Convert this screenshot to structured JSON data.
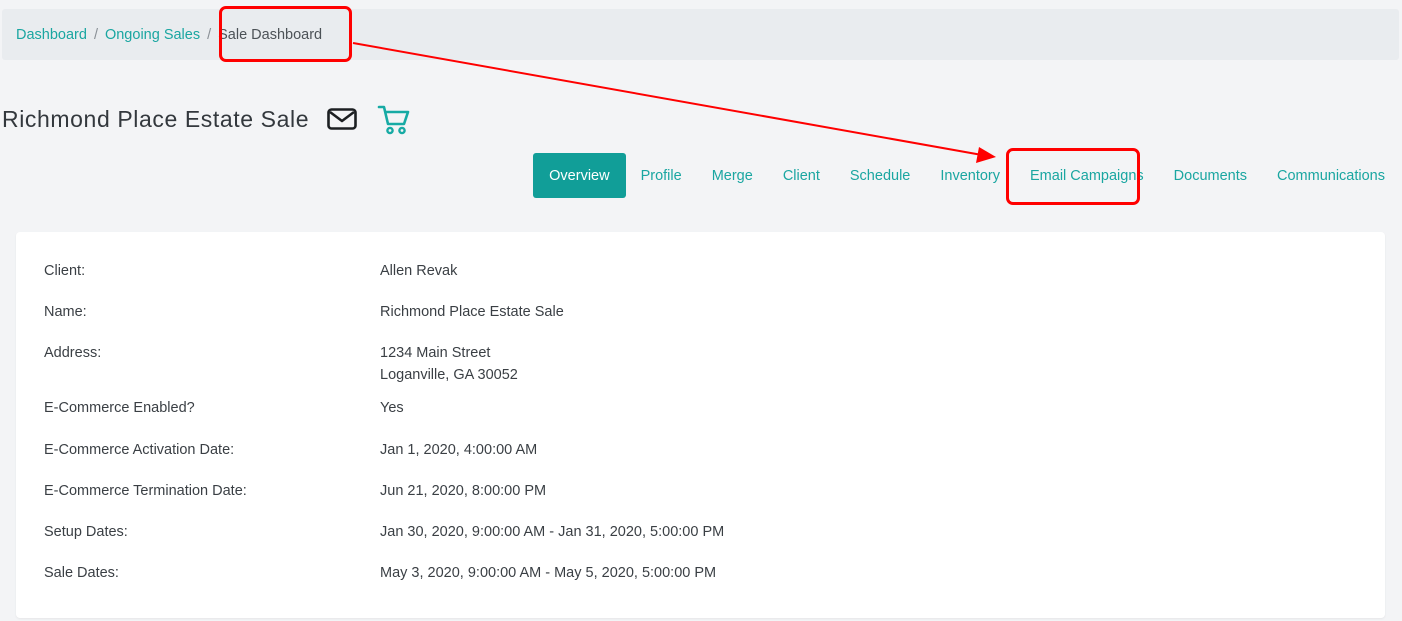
{
  "breadcrumb": {
    "items": [
      {
        "label": "Dashboard"
      },
      {
        "label": "Ongoing Sales"
      }
    ],
    "separator": "/",
    "current": "Sale Dashboard"
  },
  "header": {
    "title": "Richmond Place Estate Sale",
    "icons": [
      "envelope-icon",
      "cart-icon"
    ]
  },
  "tabs": [
    {
      "label": "Overview",
      "active": true
    },
    {
      "label": "Profile"
    },
    {
      "label": "Merge"
    },
    {
      "label": "Client"
    },
    {
      "label": "Schedule"
    },
    {
      "label": "Inventory"
    },
    {
      "label": "Email Campaigns"
    },
    {
      "label": "Documents"
    },
    {
      "label": "Communications"
    }
  ],
  "details": [
    {
      "label": "Client:",
      "value": "Allen Revak"
    },
    {
      "label": "Name:",
      "value": "Richmond Place Estate Sale"
    },
    {
      "label": "Address:",
      "value": "1234 Main Street",
      "value2": "Loganville, GA 30052"
    },
    {
      "label": "E-Commerce Enabled?",
      "value": "Yes"
    },
    {
      "label": "E-Commerce Activation Date:",
      "value": "Jan 1, 2020, 4:00:00 AM"
    },
    {
      "label": "E-Commerce Termination Date:",
      "value": "Jun 21, 2020, 8:00:00 PM"
    },
    {
      "label": "Setup Dates:",
      "value": "Jan 30, 2020, 9:00:00 AM - Jan 31, 2020, 5:00:00 PM"
    },
    {
      "label": "Sale Dates:",
      "value": "May 3, 2020, 9:00:00 AM - May 5, 2020, 5:00:00 PM"
    }
  ],
  "colors": {
    "accent": "#119e98",
    "link": "#1aa6a1",
    "annotation": "#ff0000"
  }
}
